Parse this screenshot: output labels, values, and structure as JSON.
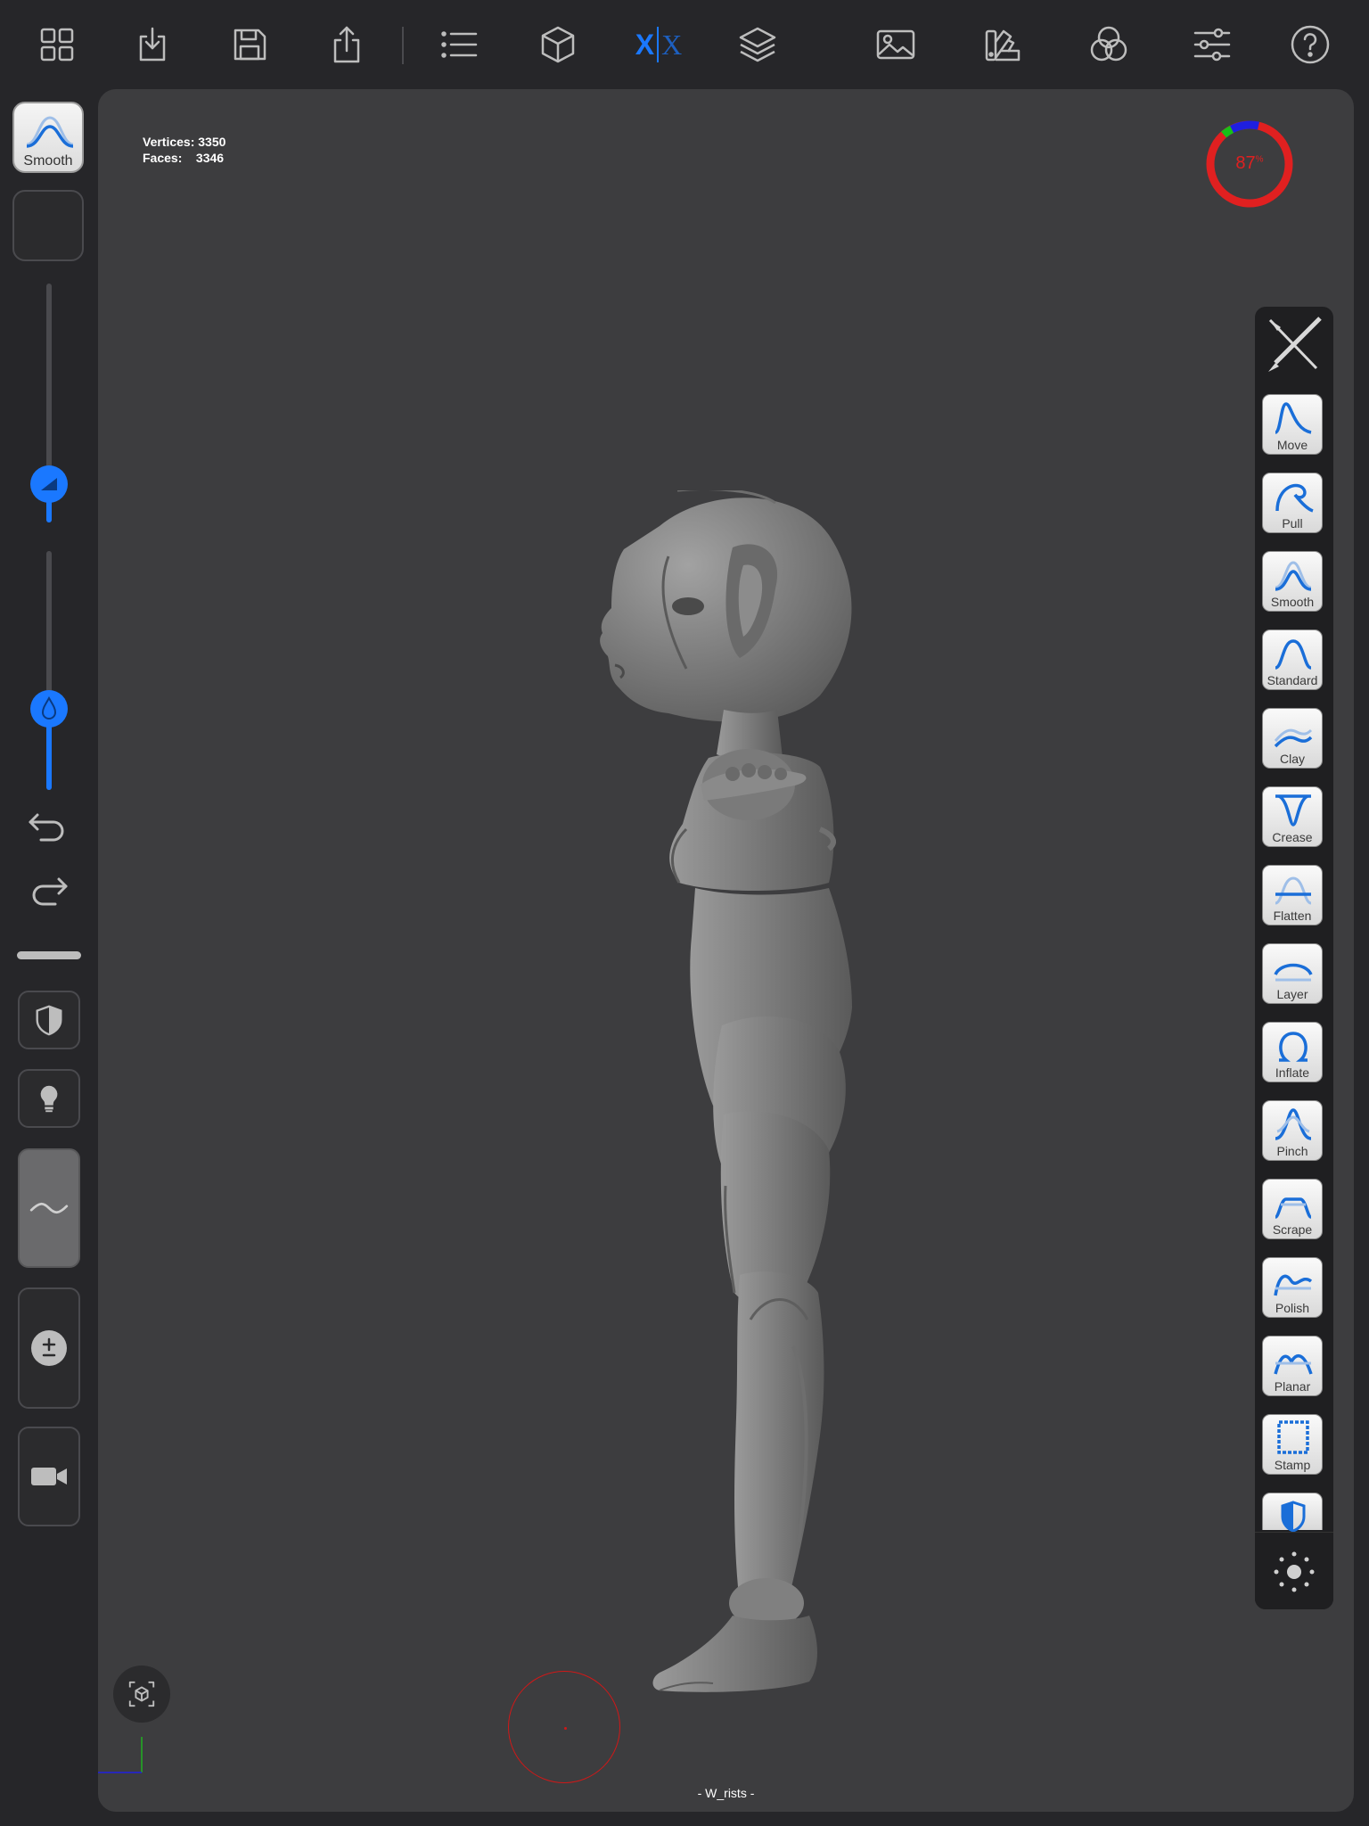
{
  "toolbar": {
    "icons": [
      "grid-icon",
      "import-icon",
      "save-icon",
      "share-icon",
      "list-icon",
      "cube-icon",
      "symmetry-icon",
      "layers-icon",
      "image-icon",
      "palette-icon",
      "color-channels-icon",
      "sliders-icon",
      "help-icon"
    ],
    "symmetry_left": "X",
    "symmetry_right": "X",
    "accent_color": "#1a78ff"
  },
  "viewport": {
    "vertices_label": "Vertices:",
    "vertices_value": "3350",
    "faces_label": "Faces:",
    "faces_value": "3346",
    "memory_percent": "87",
    "memory_unit": "%",
    "memory_color": "#e02020",
    "status_text": "- W_rists -"
  },
  "left": {
    "active_tool_label": "Smooth",
    "radius_fraction": 0.16,
    "intensity_fraction": 0.34
  },
  "tools": [
    {
      "label": "Move"
    },
    {
      "label": "Pull"
    },
    {
      "label": "Smooth"
    },
    {
      "label": "Standard"
    },
    {
      "label": "Clay"
    },
    {
      "label": "Crease"
    },
    {
      "label": "Flatten"
    },
    {
      "label": "Layer"
    },
    {
      "label": "Inflate"
    },
    {
      "label": "Pinch"
    },
    {
      "label": "Scrape"
    },
    {
      "label": "Polish"
    },
    {
      "label": "Planar"
    },
    {
      "label": "Stamp"
    }
  ]
}
